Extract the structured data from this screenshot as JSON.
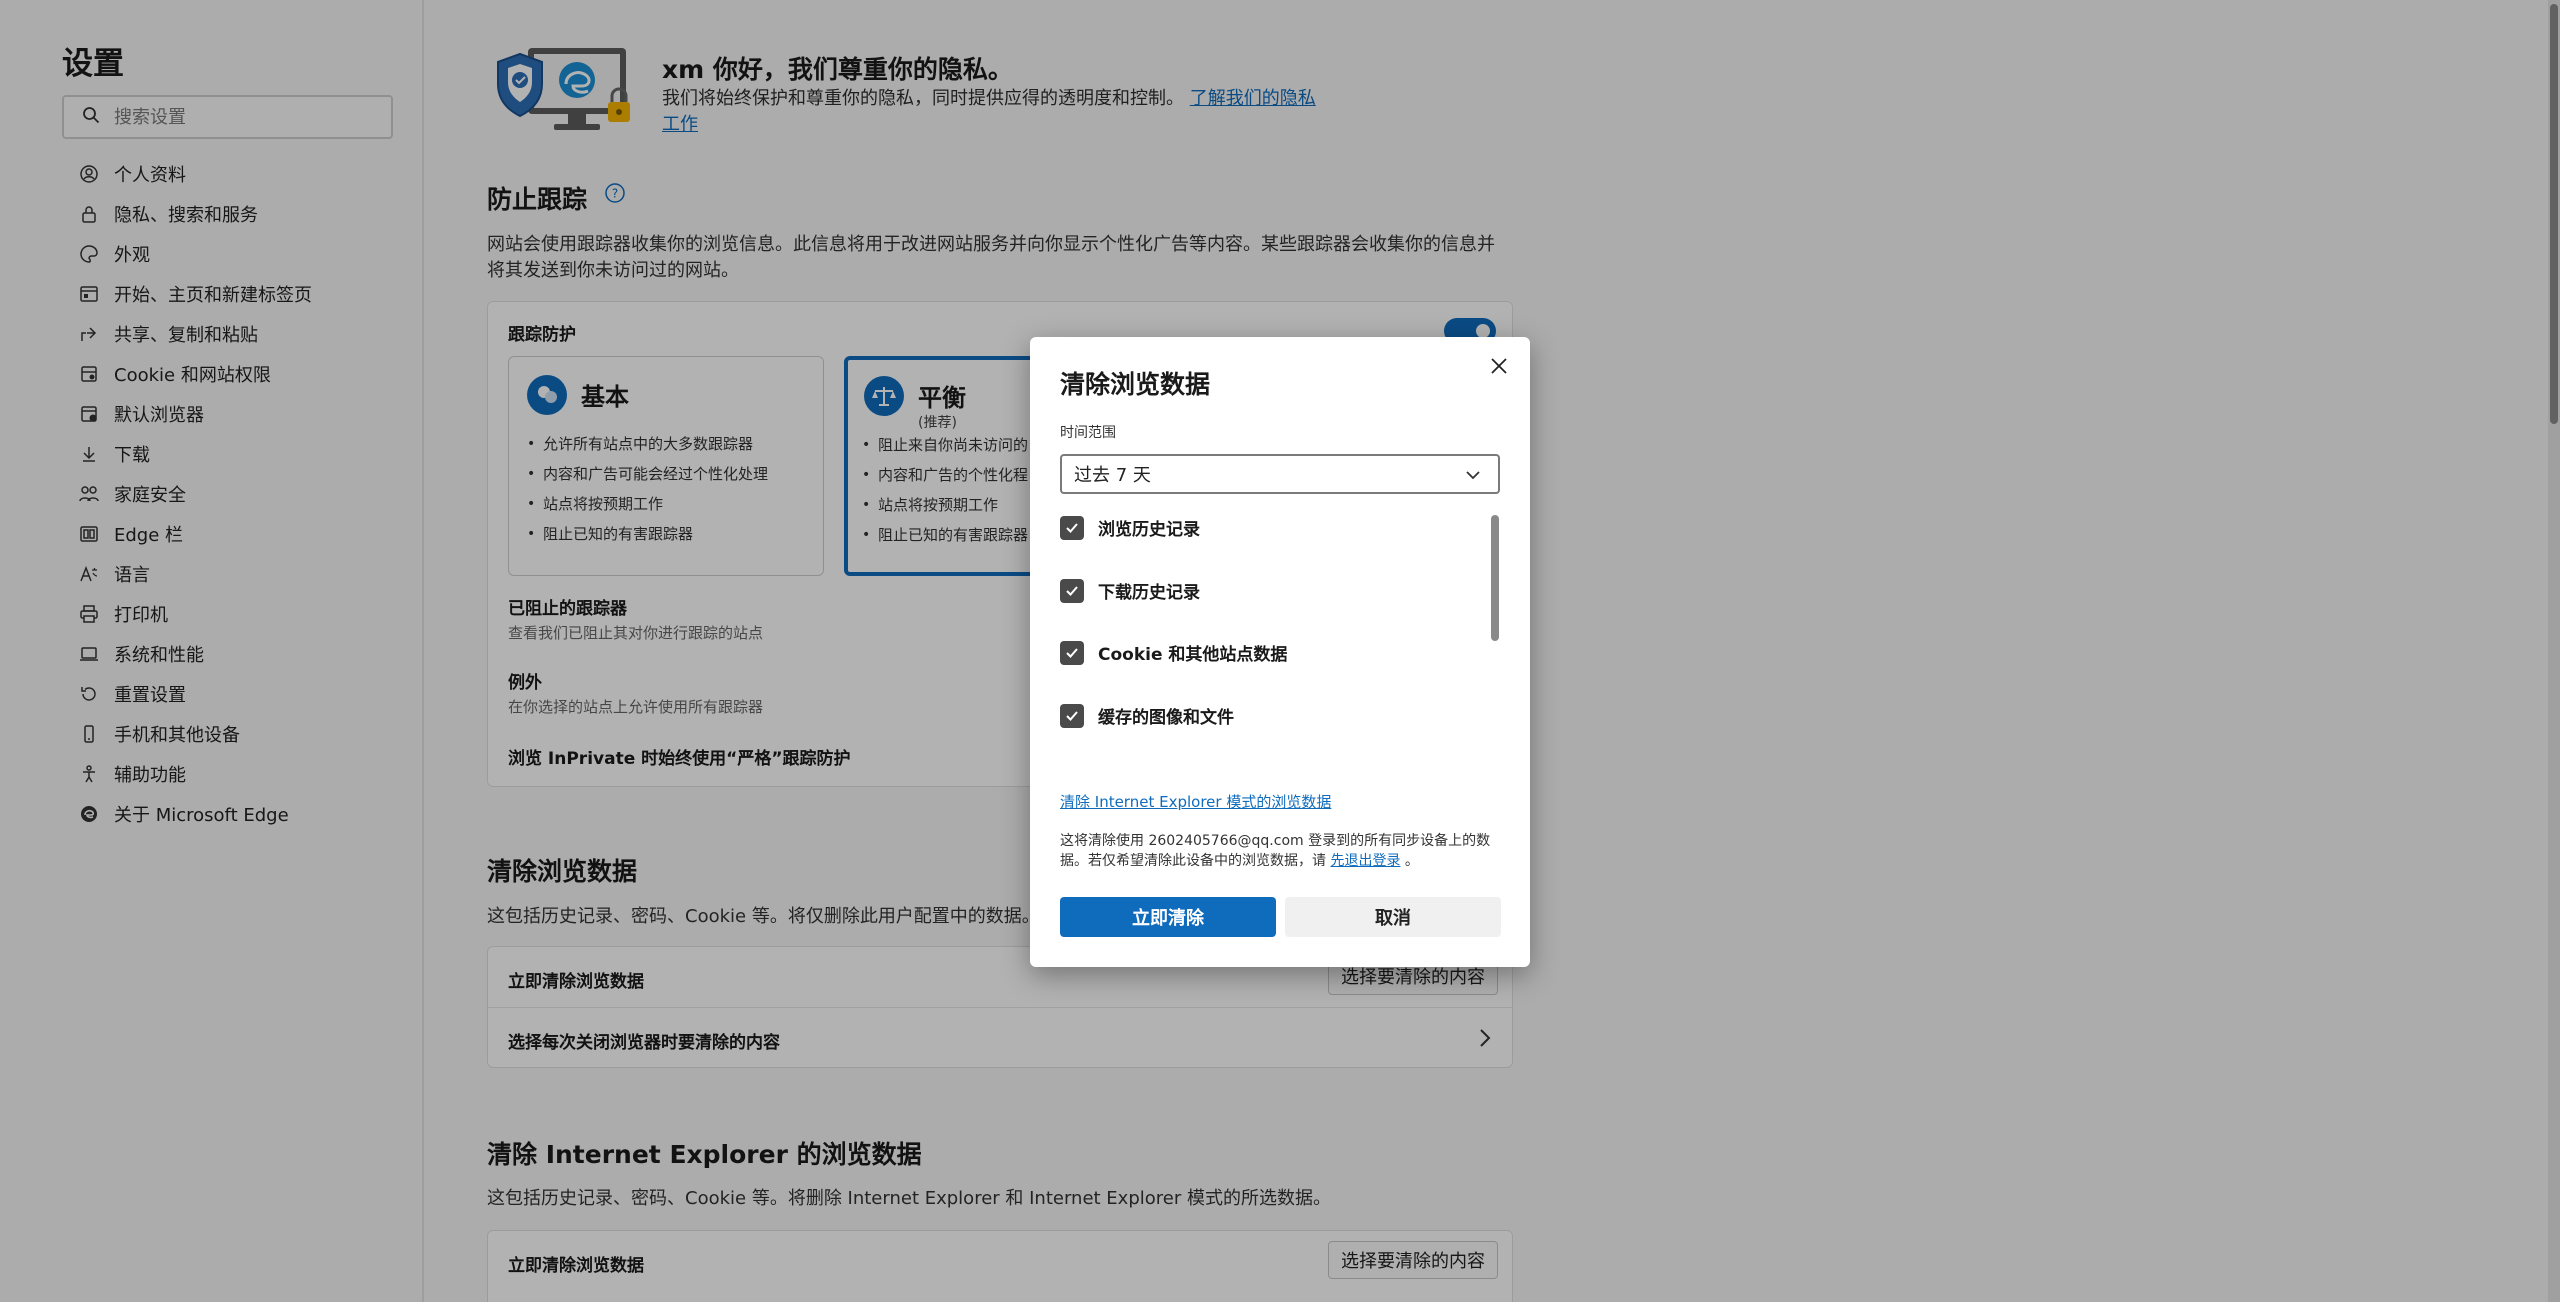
{
  "sidebar": {
    "title": "设置",
    "search_placeholder": "搜索设置",
    "items": [
      {
        "label": "个人资料",
        "icon": "profile-icon"
      },
      {
        "label": "隐私、搜索和服务",
        "icon": "lock-icon"
      },
      {
        "label": "外观",
        "icon": "appearance-icon"
      },
      {
        "label": "开始、主页和新建标签页",
        "icon": "home-icon"
      },
      {
        "label": "共享、复制和粘贴",
        "icon": "share-icon"
      },
      {
        "label": "Cookie 和网站权限",
        "icon": "cookie-icon"
      },
      {
        "label": "默认浏览器",
        "icon": "browser-icon"
      },
      {
        "label": "下载",
        "icon": "download-icon"
      },
      {
        "label": "家庭安全",
        "icon": "family-icon"
      },
      {
        "label": "Edge 栏",
        "icon": "edge-bar-icon"
      },
      {
        "label": "语言",
        "icon": "language-icon"
      },
      {
        "label": "打印机",
        "icon": "printer-icon"
      },
      {
        "label": "系统和性能",
        "icon": "system-icon"
      },
      {
        "label": "重置设置",
        "icon": "reset-icon"
      },
      {
        "label": "手机和其他设备",
        "icon": "phone-icon"
      },
      {
        "label": "辅助功能",
        "icon": "accessibility-icon"
      },
      {
        "label": "关于 Microsoft Edge",
        "icon": "edge-logo-icon"
      }
    ]
  },
  "hero": {
    "title": "xm 你好，我们尊重你的隐私。",
    "desc": "我们将始终保护和尊重你的隐私，同时提供应得的透明度和控制。",
    "link": "了解我们的隐私工作"
  },
  "tracking": {
    "title": "防止跟踪",
    "help_icon": "help-icon",
    "desc": "网站会使用跟踪器收集你的浏览信息。此信息将用于改进网站服务并向你显示个性化广告等内容。某些跟踪器会收集你的信息并将其发送到你未访问过的网站。",
    "protection_label": "跟踪防护",
    "toggle_on": true,
    "basic": {
      "title": "基本",
      "items": [
        "允许所有站点中的大多数跟踪器",
        "内容和广告可能会经过个性化处理",
        "站点将按预期工作",
        "阻止已知的有害跟踪器"
      ]
    },
    "balanced": {
      "title": "平衡",
      "sub": "(推荐)",
      "items": [
        "阻止来自你尚未访问的",
        "内容和广告的个性化程",
        "站点将按预期工作",
        "阻止已知的有害跟踪器"
      ]
    },
    "blocked_title": "已阻止的跟踪器",
    "blocked_sub": "查看我们已阻止其对你进行跟踪的站点",
    "exceptions_title": "例外",
    "exceptions_sub": "在你选择的站点上允许使用所有跟踪器",
    "inprivate": "浏览 InPrivate 时始终使用“严格”跟踪防护"
  },
  "clear": {
    "title": "清除浏览数据",
    "desc": "这包括历史记录、密码、Cookie 等。将仅删除此用户配置中的数据。",
    "row1": "立即清除浏览数据",
    "row1_button": "选择要清除的内容",
    "row2": "选择每次关闭浏览器时要清除的内容"
  },
  "ie": {
    "title": "清除 Internet Explorer 的浏览数据",
    "desc": "这包括历史记录、密码、Cookie 等。将删除 Internet Explorer 和 Internet Explorer 模式的所选数据。",
    "row1": "立即清除浏览数据",
    "row1_button": "选择要清除的内容"
  },
  "dialog": {
    "title": "清除浏览数据",
    "range_label": "时间范围",
    "range_value": "过去 7 天",
    "options": [
      {
        "label": "浏览历史记录",
        "checked": true
      },
      {
        "label": "下载历史记录",
        "checked": true
      },
      {
        "label": "Cookie 和其他站点数据",
        "checked": true
      },
      {
        "label": "缓存的图像和文件",
        "checked": true
      }
    ],
    "ie_link": "清除 Internet Explorer 模式的浏览数据",
    "note": "这将清除使用 2602405766@qq.com 登录到的所有同步设备上的数据。若仅希望清除此设备中的浏览数据，请",
    "note_link": "先退出登录",
    "note_end": "。",
    "primary": "立即清除",
    "secondary": "取消"
  },
  "colors": {
    "accent": "#0f6cbd",
    "overlay": "rgba(0,0,0,0.30)"
  }
}
